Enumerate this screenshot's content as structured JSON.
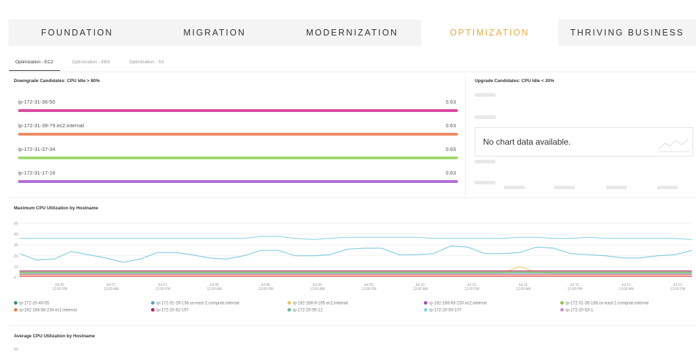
{
  "nav": {
    "tabs": [
      {
        "label": "FOUNDATION",
        "active": false
      },
      {
        "label": "MIGRATION",
        "active": false
      },
      {
        "label": "MODERNIZATION",
        "active": false
      },
      {
        "label": "OPTIMIZATION",
        "active": true
      },
      {
        "label": "THRIVING BUSINESS",
        "active": false
      }
    ],
    "active_color": "#f0a63a"
  },
  "subtabs": [
    {
      "label": "Optimization - EC2",
      "active": true
    },
    {
      "label": "Optimization - EBS",
      "active": false
    },
    {
      "label": "Optimization - S3",
      "active": false
    }
  ],
  "downgrade": {
    "title": "Downgrade Candidates: CPU Idle > 80%",
    "rows": [
      {
        "host": "ip-172-31-36-50",
        "value": "0.63",
        "fraction": 1.0,
        "color": "#d9489e"
      },
      {
        "host": "ip-172-31-39-79.ec2.internal",
        "value": "0.63",
        "fraction": 1.0,
        "color": "#ef8b63"
      },
      {
        "host": "ip-172-31-37-34",
        "value": "0.63",
        "fraction": 1.0,
        "color": "#9fd96b"
      },
      {
        "host": "ip-172-31-17-16",
        "value": "0.63",
        "fraction": 1.0,
        "color": "#b06cd4"
      }
    ]
  },
  "upgrade": {
    "title": "Upgrade Candidates: CPU Idle < 20%",
    "no_data": "No chart data available."
  },
  "max_chart": {
    "title": "Maximum CPU Utilization by Hostname",
    "chart_data": {
      "type": "line",
      "ylim": [
        0,
        50
      ],
      "yticks": [
        "50",
        "40",
        "30",
        "20",
        "10",
        "0"
      ],
      "x_tick_labels": [
        [
          "Jul 06,",
          "12:00 PM"
        ],
        [
          "Jul 07,",
          "12:00 AM"
        ],
        [
          "Jul 07,",
          "12:00 PM"
        ],
        [
          "Jul 08,",
          "12:00 AM"
        ],
        [
          "Jul 08,",
          "12:00 PM"
        ],
        [
          "Jul 09,",
          "12:00 AM"
        ],
        [
          "Jul 09,",
          "12:00 PM"
        ],
        [
          "Jul 10,",
          "12:00 AM"
        ],
        [
          "Jul 10,",
          "12:00 PM"
        ],
        [
          "Jul 11,",
          "12:00 AM"
        ],
        [
          "Jul 11,",
          "12:00 PM"
        ],
        [
          "Jul 12,",
          "12:00 AM"
        ],
        [
          "Jul 12,",
          "12:00 PM"
        ]
      ],
      "series": [
        {
          "name": "ip-172-20-49-55",
          "color": "#2f8b8b",
          "values": [
            5,
            5,
            5,
            5,
            5,
            5,
            5,
            5,
            5,
            5,
            5,
            5,
            5,
            5,
            5,
            5,
            5,
            5,
            5,
            5,
            5,
            5,
            5,
            5,
            5,
            5,
            5,
            5,
            5,
            5,
            5,
            5,
            5,
            5,
            5,
            5,
            5,
            5,
            5,
            5
          ]
        },
        {
          "name": "ip-172-31-29-136.us-east-2.compute.internal",
          "color": "#4aa3c9",
          "values": [
            6,
            6,
            6,
            6,
            6,
            6,
            6,
            6,
            6,
            6,
            6,
            6,
            6,
            6,
            6,
            6,
            6,
            6,
            6,
            6,
            6,
            6,
            6,
            6,
            6,
            6,
            6,
            6,
            6,
            6,
            6,
            6,
            6,
            6,
            6,
            6,
            6,
            6,
            6,
            6
          ]
        },
        {
          "name": "ip-192-168-8-165.ec2.internal",
          "color": "#f2c14e",
          "values": [
            4,
            4,
            4,
            4,
            4,
            4,
            4,
            4,
            4,
            4,
            4,
            4,
            4,
            4,
            4,
            4,
            4,
            4,
            4,
            4,
            4,
            4,
            4,
            4,
            4,
            4,
            4,
            4,
            4,
            10,
            5,
            4,
            4,
            4,
            4,
            4,
            4,
            4,
            4,
            4
          ]
        },
        {
          "name": "ip-192-168-63-233.ec2.internal",
          "color": "#9b4fb6",
          "values": [
            3,
            3,
            3,
            3,
            3,
            3,
            3,
            3,
            3,
            3,
            3,
            3,
            3,
            3,
            3,
            3,
            3,
            3,
            3,
            3,
            3,
            3,
            3,
            3,
            3,
            3,
            3,
            3,
            3,
            3,
            3,
            3,
            3,
            3,
            3,
            3,
            3,
            3,
            3,
            3
          ]
        },
        {
          "name": "ip-172-31-35-188.us-east-2.compute.internal",
          "color": "#8cc63f",
          "values": [
            5,
            5,
            5,
            5,
            5,
            5,
            5,
            5,
            5,
            5,
            5,
            5,
            5,
            5,
            5,
            5,
            5,
            5,
            5,
            5,
            5,
            5,
            5,
            5,
            5,
            5,
            5,
            5,
            5,
            5,
            5,
            5,
            5,
            5,
            5,
            5,
            5,
            5,
            5,
            5
          ]
        },
        {
          "name": "ip-192-168-58-234.ec2.internal",
          "color": "#f07a3c",
          "values": [
            2,
            2,
            2,
            2,
            2,
            2,
            2,
            2,
            2,
            2,
            2,
            2,
            2,
            2,
            2,
            2,
            2,
            2,
            2,
            2,
            2,
            2,
            2,
            2,
            2,
            2,
            2,
            2,
            2,
            2,
            2,
            2,
            2,
            2,
            2,
            2,
            2,
            2,
            2,
            2
          ]
        },
        {
          "name": "ip-172-20-62-157",
          "color": "#c2185b",
          "values": [
            6,
            6,
            6,
            6,
            6,
            6,
            6,
            6,
            6,
            6,
            6,
            6,
            6,
            6,
            6,
            6,
            6,
            6,
            6,
            6,
            6,
            6,
            6,
            6,
            6,
            6,
            6,
            6,
            6,
            6,
            6,
            6,
            6,
            6,
            6,
            6,
            6,
            6,
            6,
            6
          ]
        },
        {
          "name": "ip-172-20-55-12",
          "color": "#5fbf9b",
          "values": [
            4,
            4,
            4,
            4,
            4,
            4,
            4,
            4,
            4,
            4,
            4,
            4,
            4,
            4,
            4,
            4,
            4,
            4,
            4,
            4,
            4,
            4,
            4,
            4,
            4,
            4,
            4,
            4,
            4,
            4,
            4,
            4,
            4,
            4,
            4,
            4,
            4,
            4,
            4,
            4
          ]
        },
        {
          "name": "ip-172-20-50-107",
          "color": "#7fd0e6",
          "values": [
            36,
            36,
            36,
            36,
            36,
            36,
            36,
            36,
            36,
            36,
            36,
            36,
            36,
            36,
            38,
            38,
            36,
            35,
            36,
            37,
            37,
            37,
            37,
            37,
            36,
            36,
            36,
            36,
            36,
            37,
            37,
            36,
            36,
            37,
            36,
            36,
            36,
            36,
            36,
            35
          ]
        },
        {
          "name": "ip-172-20-53-1",
          "color": "#c58fd9",
          "values": [
            3,
            3,
            3,
            3,
            3,
            3,
            3,
            3,
            3,
            3,
            3,
            3,
            3,
            3,
            3,
            3,
            3,
            3,
            3,
            3,
            3,
            3,
            3,
            3,
            3,
            3,
            3,
            3,
            3,
            3,
            3,
            3,
            3,
            3,
            3,
            3,
            3,
            3,
            3,
            3
          ]
        },
        {
          "name": "",
          "color": "#6cc3de",
          "values": [
            22,
            16,
            17,
            24,
            21,
            18,
            14,
            17,
            23,
            23,
            21,
            18,
            17,
            20,
            25,
            25,
            20,
            20,
            21,
            26,
            27,
            27,
            21,
            21,
            22,
            29,
            28,
            22,
            22,
            23,
            28,
            27,
            22,
            21,
            20,
            18,
            18,
            20,
            21,
            25
          ]
        },
        {
          "name": "",
          "color": "#e55353",
          "values": [
            1,
            1,
            1,
            1,
            1,
            1,
            1,
            1,
            1,
            1,
            1,
            1,
            1,
            1,
            1,
            1,
            1,
            1,
            1,
            1,
            1,
            1,
            1,
            1,
            1,
            1,
            1,
            1,
            1,
            1,
            1,
            1,
            1,
            1,
            1,
            1,
            1,
            1,
            1,
            1
          ]
        }
      ]
    }
  },
  "legend": [
    {
      "label": "ip-172-20-49-55",
      "color": "#2f8b8b"
    },
    {
      "label": "ip-172-31-29-136.us-east-2.compute.internal",
      "color": "#4aa3c9"
    },
    {
      "label": "ip-192-168-8-165.ec2.internal",
      "color": "#f2c14e"
    },
    {
      "label": "ip-192-168-63-233.ec2.internal",
      "color": "#9b4fb6"
    },
    {
      "label": "ip-172-31-35-188.us-east-2.compute.internal",
      "color": "#8cc63f"
    },
    {
      "label": "ip-192-168-58-234.ec2.internal",
      "color": "#f07a3c"
    },
    {
      "label": "ip-172-20-62-157",
      "color": "#c2185b"
    },
    {
      "label": "ip-172-20-55-12",
      "color": "#5fbf9b"
    },
    {
      "label": "ip-172-20-50-107",
      "color": "#7fd0e6"
    },
    {
      "label": "ip-172-20-53-1",
      "color": "#c58fd9"
    }
  ],
  "avg_chart": {
    "title": "Average CPU Utilization by Hostname",
    "first_ytick": "50"
  }
}
